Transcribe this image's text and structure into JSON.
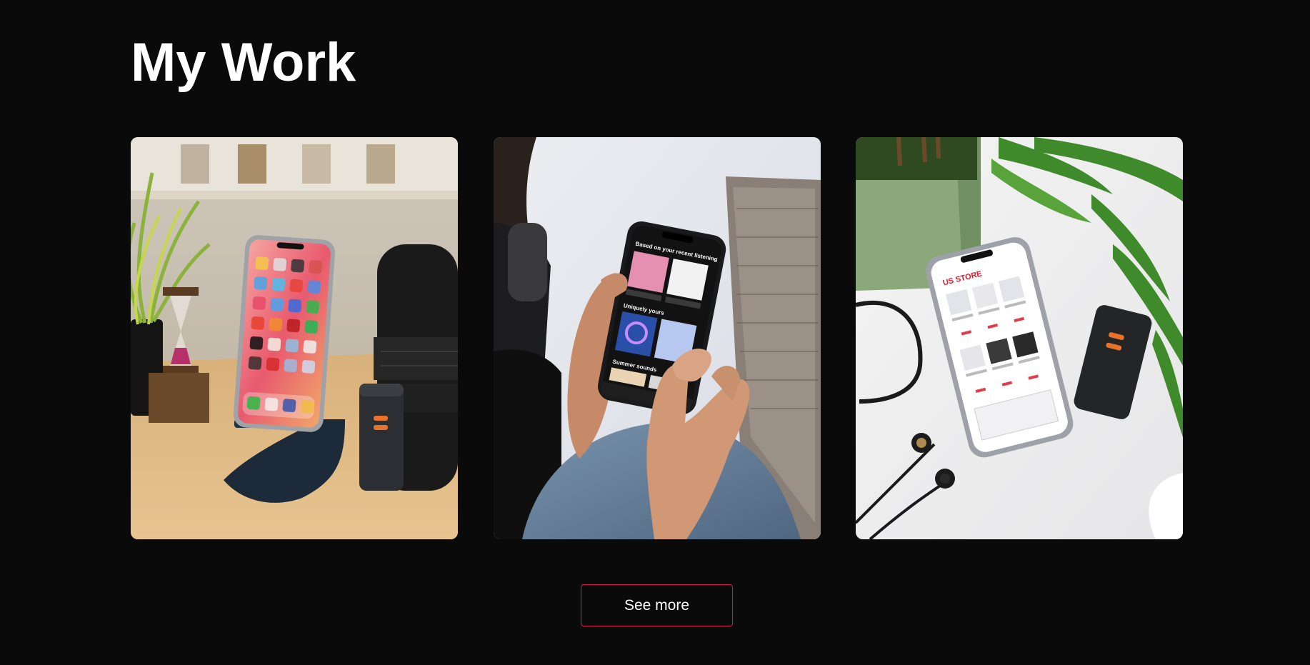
{
  "section": {
    "title": "My Work"
  },
  "projects": [
    {
      "image": "phone-on-stand-desk-photo",
      "screen_app": "ios-home-screen"
    },
    {
      "image": "hands-holding-phone-photo",
      "screen_app": "music-streaming-app",
      "screen_texts": [
        "Based on your recent listening",
        "Uniquely yours",
        "Summer sounds"
      ]
    },
    {
      "image": "phone-on-table-store-photo",
      "screen_app": "us-store-ecommerce-app",
      "screen_texts": [
        "US STORE"
      ]
    }
  ],
  "actions": {
    "see_more_label": "See more"
  },
  "colors": {
    "background": "#0a0a0a",
    "accent_border": "#d21f4a",
    "text": "#ffffff"
  }
}
